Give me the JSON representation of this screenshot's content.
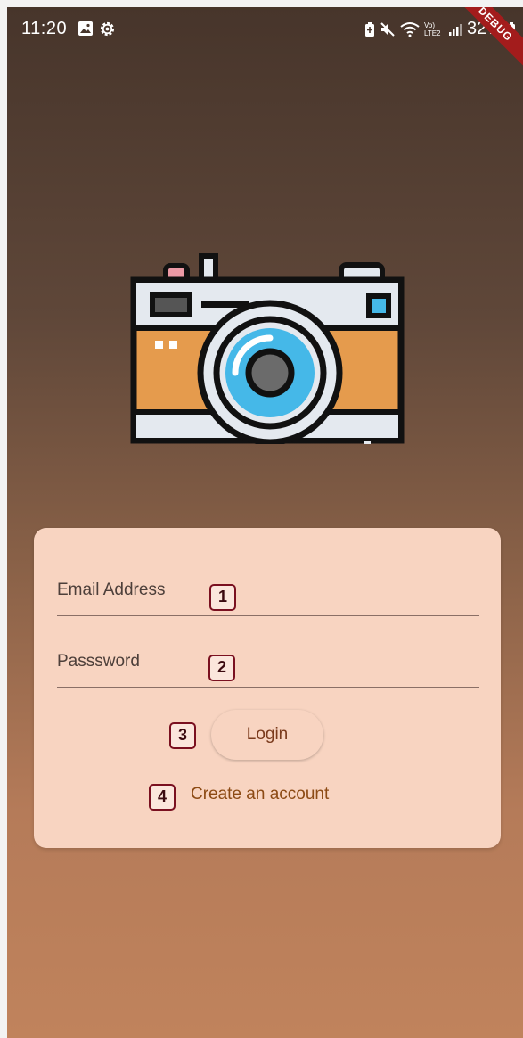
{
  "status_bar": {
    "time": "11:20",
    "network_label": "Vo) LTE2",
    "battery_text": "32%",
    "debug_banner": "DEBUG"
  },
  "logo": {
    "icon": "camera-icon"
  },
  "login_form": {
    "email_label": "Email Address",
    "email_value": "",
    "password_label": "Passsword",
    "password_value": "",
    "login_label": "Login",
    "create_account_label": "Create an account"
  },
  "annotations": [
    "1",
    "2",
    "3",
    "4"
  ],
  "colors": {
    "card_background": "#f8d4c1",
    "link_color": "#8c4a14",
    "badge_border": "#7a1020",
    "gradient_top": "#47352b",
    "gradient_bottom": "#c0835c"
  }
}
